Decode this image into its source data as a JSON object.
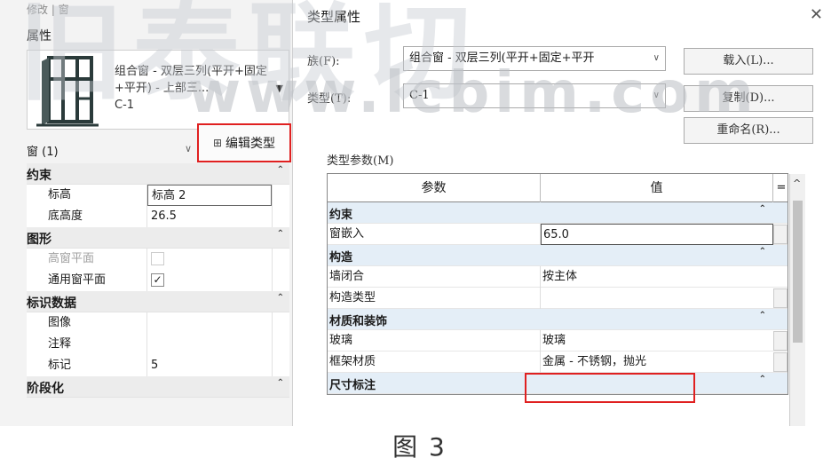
{
  "watermark": {
    "big": "旧泰联切",
    "url": "www.lcbim.com"
  },
  "left": {
    "top_tabs": "修改 | 窗",
    "panel_title": "属性",
    "type_name": "组合窗 - 双层三列(平开+固定+平开) - 上部三...",
    "type_id": "C-1",
    "instance_label": "窗 (1)",
    "edit_type_label": "编辑类型",
    "groups": [
      {
        "name": "约束",
        "rows": [
          {
            "name": "标高",
            "value": "标高 2"
          },
          {
            "name": "底高度",
            "value": "26.5"
          }
        ]
      },
      {
        "name": "图形",
        "rows": [
          {
            "name": "高窗平面",
            "value": ""
          },
          {
            "name": "通用窗平面",
            "value": "✓"
          }
        ]
      },
      {
        "name": "标识数据",
        "rows": [
          {
            "name": "图像",
            "value": ""
          },
          {
            "name": "注释",
            "value": ""
          },
          {
            "name": "标记",
            "value": "5"
          }
        ]
      },
      {
        "name": "阶段化",
        "rows": []
      }
    ]
  },
  "dialog": {
    "title": "类型属性",
    "family_label": "族(F):",
    "family_value": "组合窗 - 双层三列(平开+固定+平开",
    "type_label": "类型(T):",
    "type_value": "C-1",
    "load_button": "载入(L)...",
    "duplicate_button": "复制(D)...",
    "rename_button": "重命名(R)...",
    "params_label": "类型参数(M)",
    "col_param": "参数",
    "col_value": "值",
    "col_eq": "=",
    "groups": [
      {
        "name": "约束",
        "rows": [
          {
            "name": "窗嵌入",
            "value": "65.0"
          }
        ]
      },
      {
        "name": "构造",
        "rows": [
          {
            "name": "墙闭合",
            "value": "按主体"
          },
          {
            "name": "构造类型",
            "value": ""
          }
        ]
      },
      {
        "name": "材质和装饰",
        "rows": [
          {
            "name": "玻璃",
            "value": "玻璃"
          },
          {
            "name": "框架材质",
            "value": "金属 - 不锈钢，抛光"
          }
        ]
      },
      {
        "name": "尺寸标注",
        "rows": []
      }
    ]
  },
  "caption": "图 3"
}
